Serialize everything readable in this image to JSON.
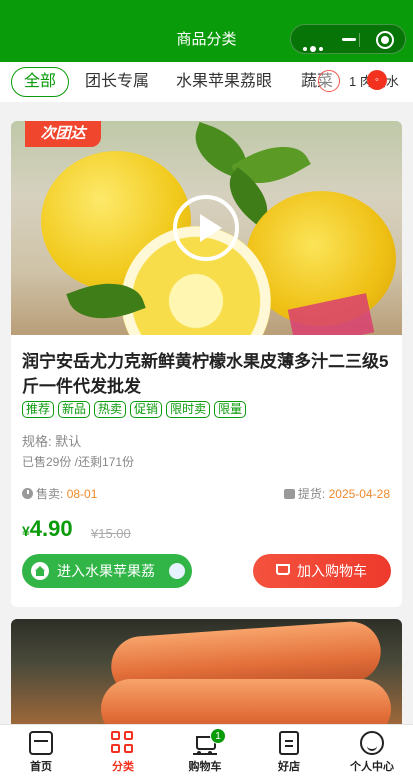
{
  "header": {
    "title": "商品分类"
  },
  "tabs": [
    {
      "label": "全部",
      "active": true
    },
    {
      "label": "团长专属",
      "active": false
    },
    {
      "label": "水果苹果荔眼",
      "active": false
    },
    {
      "label": "蔬菜",
      "active": false
    },
    {
      "label": "1 肉蛋水",
      "active": false
    }
  ],
  "colors": {
    "brand_green": "#0a9b0a",
    "accent_red": "#f2321f",
    "accent_orange": "#f08a2a"
  },
  "product": {
    "brand_badge": "次团达",
    "title": "润宁安岳尤力克新鲜黄柠檬水果皮薄多汁二三级5斤一件代发批发",
    "tags": [
      "推荐",
      "新品",
      "热卖",
      "促销",
      "限时卖",
      "限量"
    ],
    "spec": "规格: 默认",
    "sold": "已售29份 /还剩171份",
    "sale_label": "售卖:",
    "sale_value": "08-01",
    "pickup_label": "提货:",
    "pickup_value": "2025-04-28",
    "price_symbol": "¥",
    "price": "4.90",
    "original_price": "¥15.00",
    "enter_button": "进入水果苹果荔",
    "cart_button": "加入购物车"
  },
  "bottom_nav": [
    {
      "label": "首页",
      "icon": "home-icon",
      "active": false
    },
    {
      "label": "分类",
      "icon": "category-icon",
      "active": true
    },
    {
      "label": "购物车",
      "icon": "cart-icon",
      "active": false,
      "badge": "1"
    },
    {
      "label": "好店",
      "icon": "store-icon",
      "active": false
    },
    {
      "label": "个人中心",
      "icon": "user-icon",
      "active": false
    }
  ]
}
